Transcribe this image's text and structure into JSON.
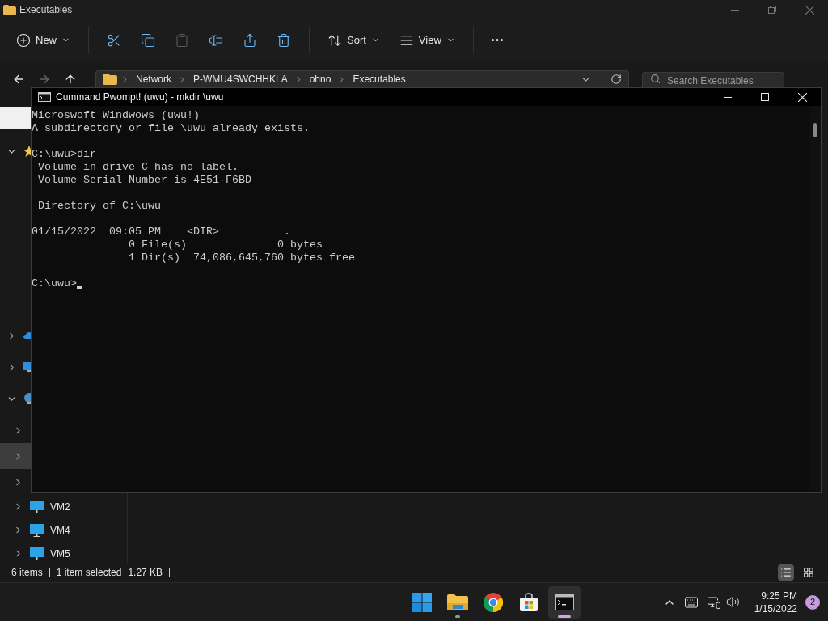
{
  "explorer": {
    "title": "Executables",
    "toolbar": [
      {
        "kind": "button",
        "label": "New",
        "menu": true,
        "disabled": false
      },
      {
        "kind": "separator"
      },
      {
        "kind": "button",
        "disabled": false
      },
      {
        "kind": "button",
        "disabled": false
      },
      {
        "kind": "button",
        "disabled": true
      },
      {
        "kind": "button",
        "disabled": false
      },
      {
        "kind": "button",
        "disabled": false
      },
      {
        "kind": "button",
        "disabled": false
      },
      {
        "kind": "separator"
      },
      {
        "kind": "button",
        "label": "Sort",
        "menu": true,
        "disabled": false
      },
      {
        "kind": "button",
        "label": "View",
        "menu": true,
        "disabled": false
      },
      {
        "kind": "separator"
      },
      {
        "kind": "button",
        "disabled": false
      }
    ],
    "nav": [
      {
        "disabled": false
      },
      {
        "disabled": true
      },
      {
        "disabled": false
      }
    ],
    "address": {
      "path": [
        "Network",
        "P-WMU4SWCHHKLA",
        "ohno",
        "Executables"
      ]
    },
    "search": {
      "placeholder": "Search Executables"
    },
    "sidebar": [
      {
        "expanded": true,
        "selected": false
      },
      {
        "expanded": false,
        "selected": false
      },
      {
        "expanded": false,
        "selected": false
      },
      {
        "expanded": true,
        "selected": false,
        "children": [
          {
            "expanded": false,
            "selected": false
          },
          {
            "expanded": false,
            "selected": true
          },
          {
            "expanded": false,
            "selected": false
          },
          {
            "label": "VM2",
            "expanded": false,
            "selected": false
          },
          {
            "label": "VM4",
            "expanded": false,
            "selected": false
          },
          {
            "label": "VM5",
            "expanded": false,
            "selected": false
          }
        ]
      }
    ],
    "status_bar": [
      "6 items",
      "1 item selected",
      "1.27 KB"
    ],
    "view_toggles": [
      {
        "selected": true
      },
      {
        "selected": false
      }
    ]
  },
  "console": {
    "title": "Cummand Pwompt! (uwu) - mkdir \\uwu",
    "blocks": [
      [
        "Microswoft Windwows (uwu!)",
        "A subdirectory or file \\uwu already exists."
      ],
      [
        "C:\\uwu>dir",
        " Volume in drive C has no label.",
        " Volume Serial Number is 4E51-F6BD"
      ],
      [
        " Directory of C:\\uwu"
      ],
      [
        "01/15/2022  09:05 PM    <DIR>          .",
        "               0 File(s)              0 bytes",
        "               1 Dir(s)  74,086,645,760 bytes free"
      ]
    ],
    "prompt": "C:\\uwu>"
  },
  "taskbar": {
    "apps": [
      {
        "running": false,
        "selected": false
      },
      {
        "running": true,
        "selected": false
      },
      {
        "running": false,
        "selected": false
      },
      {
        "running": false,
        "selected": false
      },
      {
        "running": true,
        "selected": true
      }
    ],
    "time": "9:25 PM",
    "date": "1/15/2022",
    "notifications": "2"
  }
}
